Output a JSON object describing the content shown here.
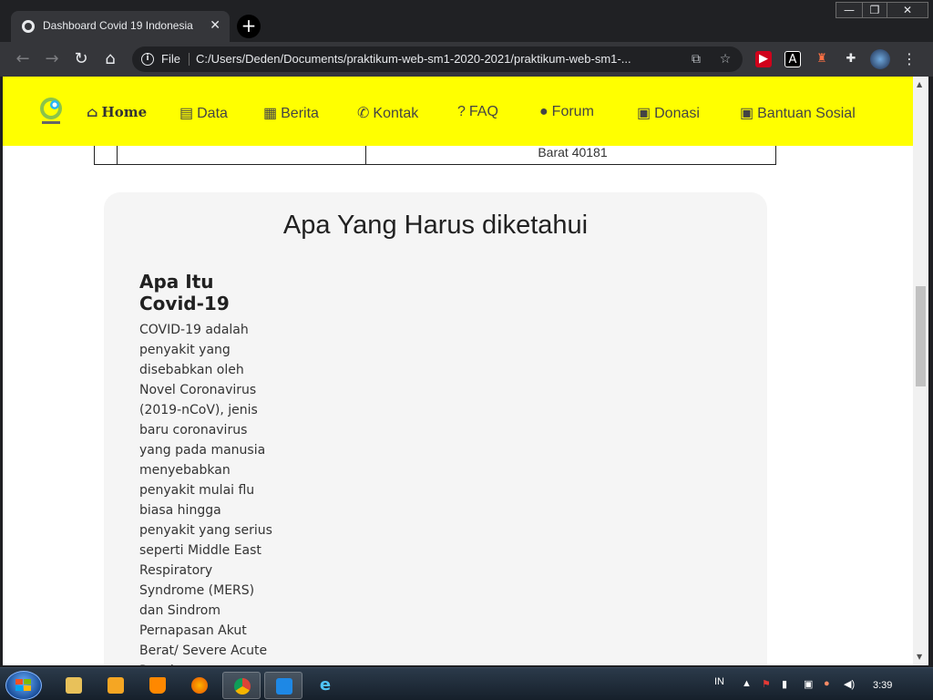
{
  "browser": {
    "tab_title": "Dashboard Covid 19 Indonesia",
    "tab_close": "✕",
    "new_tab": "+",
    "url_scheme_label": "File",
    "url": "C:/Users/Deden/Documents/praktikum-web-sm1-2020-2021/praktikum-web-sm1-...",
    "window_controls": {
      "minimize": "—",
      "maximize": "❐",
      "close": "✕"
    }
  },
  "navbar": {
    "items": [
      {
        "label": "Home",
        "icon": "home-icon"
      },
      {
        "label": "Data",
        "icon": "database-icon"
      },
      {
        "label": "Berita",
        "icon": "newspaper-icon"
      },
      {
        "label": "Kontak",
        "icon": "phone-icon"
      },
      {
        "label": "FAQ",
        "icon": "question-circle-icon"
      },
      {
        "label": "Forum",
        "icon": "comment-icon"
      },
      {
        "label": "Donasi",
        "icon": "box-open-icon"
      },
      {
        "label": "Bantuan Sosial",
        "icon": "box-open-icon"
      }
    ],
    "background": "#ffff00"
  },
  "table_remnant": {
    "cell_text": "Barat 40181"
  },
  "section": {
    "title": "Apa Yang Harus diketahui",
    "info_title": "Apa Itu Covid-19",
    "info_text": "COVID-19 adalah penyakit yang disebabkan oleh Novel Coronavirus (2019-nCoV), jenis baru coronavirus yang pada manusia menyebabkan penyakit mulai flu biasa hingga penyakit yang serius seperti Middle East Respiratory Syndrome (MERS) dan Sindrom Pernapasan Akut Berat/ Severe Acute Respiratory Syndrome"
  },
  "taskbar": {
    "language": "IN",
    "time": "3:39"
  }
}
